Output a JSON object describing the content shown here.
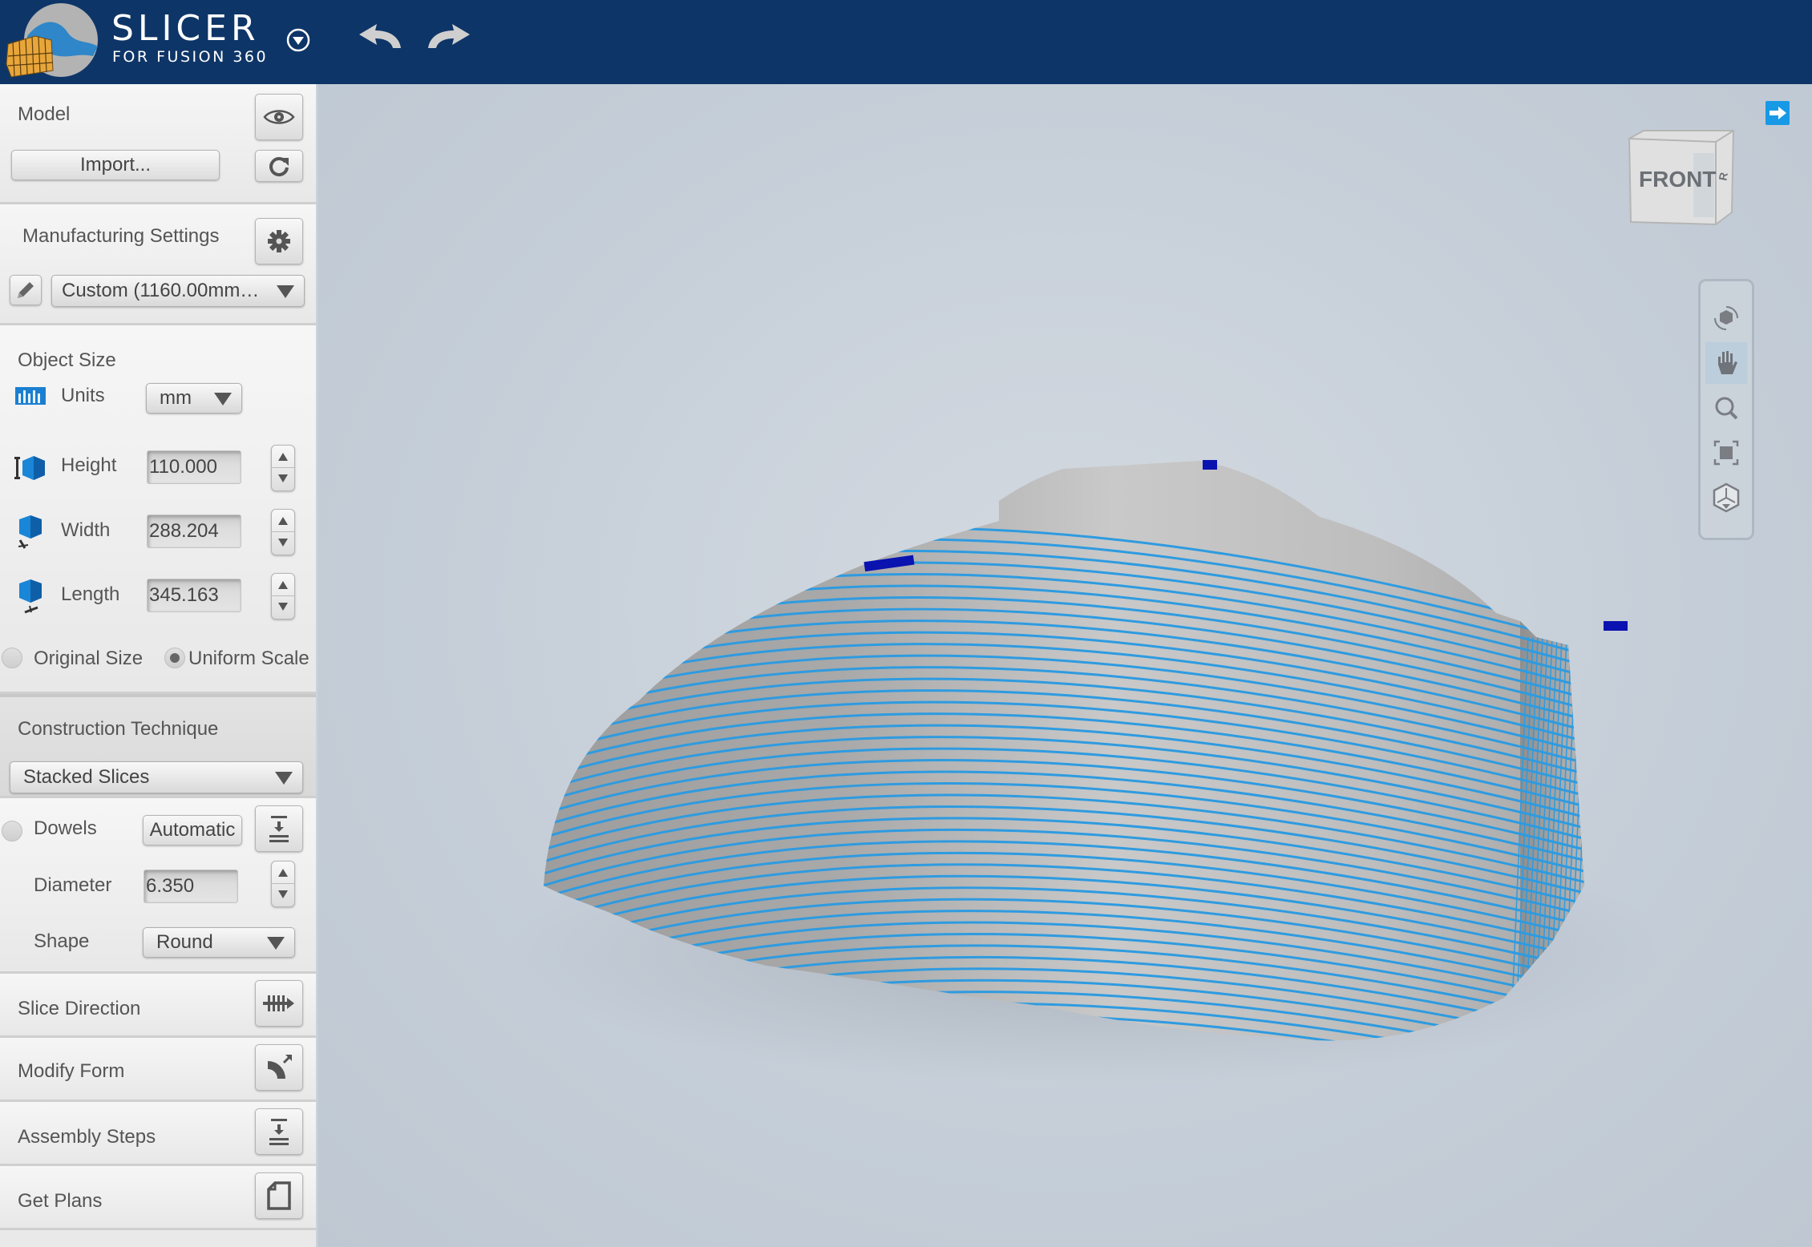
{
  "header": {
    "app_title": "SLICER",
    "app_subtitle": "FOR FUSION 360",
    "icons": [
      "app-logo-icon",
      "menu-dropdown-icon",
      "undo-icon",
      "redo-icon"
    ]
  },
  "sidebar": {
    "model": {
      "title": "Model",
      "import_label": "Import...",
      "icons": [
        "eye-icon",
        "refresh-icon"
      ]
    },
    "manufacturing": {
      "title": "Manufacturing Settings",
      "preset_value": "Custom (1160.00mm…",
      "icons": [
        "gear-icon",
        "pencil-icon"
      ]
    },
    "object_size": {
      "title": "Object Size",
      "units_label": "Units",
      "units_value": "mm",
      "height_label": "Height",
      "height_value": "110.000",
      "width_label": "Width",
      "width_value": "288.204",
      "length_label": "Length",
      "length_value": "345.163",
      "original_size_label": "Original Size",
      "original_size_checked": false,
      "uniform_scale_label": "Uniform Scale",
      "uniform_scale_checked": true
    },
    "construction": {
      "title": "Construction Technique",
      "value": "Stacked Slices"
    },
    "dowels": {
      "label": "Dowels",
      "enabled": false,
      "mode_label": "Automatic",
      "diameter_label": "Diameter",
      "diameter_value": "6.350",
      "shape_label": "Shape",
      "shape_value": "Round"
    },
    "steps": [
      {
        "label": "Slice Direction",
        "icon": "slice-direction-icon"
      },
      {
        "label": "Modify Form",
        "icon": "modify-form-icon"
      },
      {
        "label": "Assembly Steps",
        "icon": "assembly-steps-icon"
      },
      {
        "label": "Get Plans",
        "icon": "get-plans-icon"
      }
    ]
  },
  "viewport": {
    "viewcube_face": "FRONT",
    "viewcube_side": "RIGHT",
    "nav_tools": [
      "orbit",
      "pan",
      "zoom",
      "fit-to-view",
      "home-view"
    ],
    "active_nav_tool": "pan",
    "colors": {
      "background": "#c5ced8",
      "slice_line": "#2e9be0",
      "slice_fill": "#b8b8b8",
      "highlight": "#0a12b0"
    }
  }
}
